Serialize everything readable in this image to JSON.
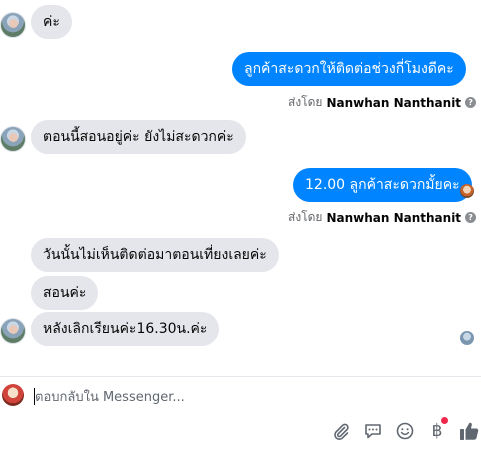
{
  "thread": {
    "messages": [
      {
        "side": "in",
        "text": "ค่ะ"
      },
      {
        "side": "out",
        "text": "ลูกค้าสะดวกให้ติดต่อช่วงกี่โมงดีคะ"
      },
      {
        "side": "in",
        "text": "ตอนนี้สอนอยู่ค่ะ  ยังไม่สะดวกค่ะ"
      },
      {
        "side": "out",
        "text": "12.00 ลูกค้าสะดวกมั้ยคะ"
      },
      {
        "side": "in",
        "text": "วันนั้นไม่เห็นติดต่อมาตอนเที่ยงเลยค่ะ"
      },
      {
        "side": "in",
        "text": "สอนค่ะ"
      },
      {
        "side": "in",
        "text": "หลังเลิกเรียนค่ะ16.30น.ค่ะ"
      }
    ],
    "sent_by": [
      {
        "prefix": "ส่งโดย",
        "name": "Nanwhan Nanthanit",
        "info_glyph": "?"
      },
      {
        "prefix": "ส่งโดย",
        "name": "Nanwhan Nanthanit",
        "info_glyph": "?"
      }
    ]
  },
  "composer": {
    "placeholder": "ตอบกลับใน Messenger...",
    "value": ""
  },
  "toolbar": {
    "icons": [
      "attach-icon",
      "chat-icon",
      "emoji-icon",
      "payment-icon",
      "like-icon"
    ],
    "payment_glyph": "฿",
    "payment_badge": true
  },
  "colors": {
    "outgoing_bubble": "#0084ff",
    "incoming_bubble": "#e4e6eb",
    "notification_dot": "#f02849"
  }
}
